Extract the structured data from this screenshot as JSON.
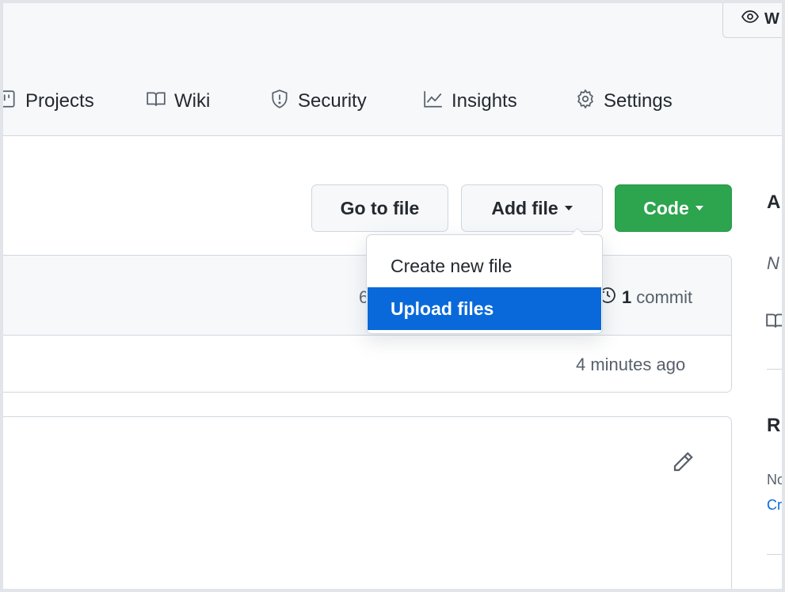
{
  "header": {
    "watch_label": "W",
    "nav": [
      {
        "label": "Projects",
        "icon": "project-icon"
      },
      {
        "label": "Wiki",
        "icon": "book-icon"
      },
      {
        "label": "Security",
        "icon": "shield-icon"
      },
      {
        "label": "Insights",
        "icon": "graph-icon"
      },
      {
        "label": "Settings",
        "icon": "gear-icon"
      }
    ]
  },
  "toolbar": {
    "go_to_file": "Go to file",
    "add_file": "Add file",
    "code": "Code"
  },
  "add_file_menu": {
    "items": [
      {
        "label": "Create new file",
        "active": false
      },
      {
        "label": "Upload files",
        "active": true
      }
    ]
  },
  "commits_box": {
    "hash_fragment": "6",
    "commit_count": "1",
    "commit_word": "commit",
    "time_ago": "4 minutes ago"
  },
  "sidebar": {
    "about_fragment": "A",
    "no_desc_fragment": "N",
    "readme_fragment": "R",
    "releases_none_fragment": "No",
    "releases_create_fragment": "Cr"
  },
  "colors": {
    "accent_blue": "#0969da",
    "code_green": "#2da44e",
    "header_bg": "#f6f8fa",
    "border": "#d0d7de"
  }
}
